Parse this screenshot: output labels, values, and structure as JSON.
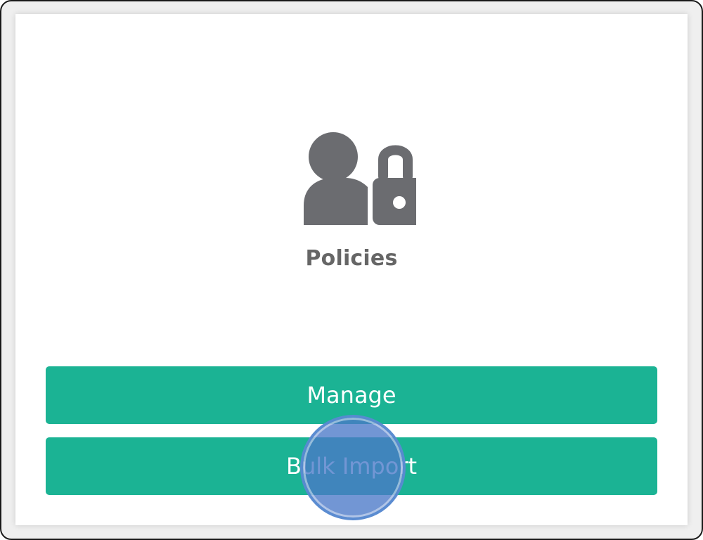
{
  "card": {
    "icon": "user-lock-icon",
    "title": "Policies"
  },
  "actions": {
    "manage_label": "Manage",
    "bulk_import_label": "Bulk Import"
  },
  "colors": {
    "accent": "#1bb394",
    "icon": "#6b6c70",
    "title": "#666666",
    "click_indicator": "#4a78c8"
  }
}
